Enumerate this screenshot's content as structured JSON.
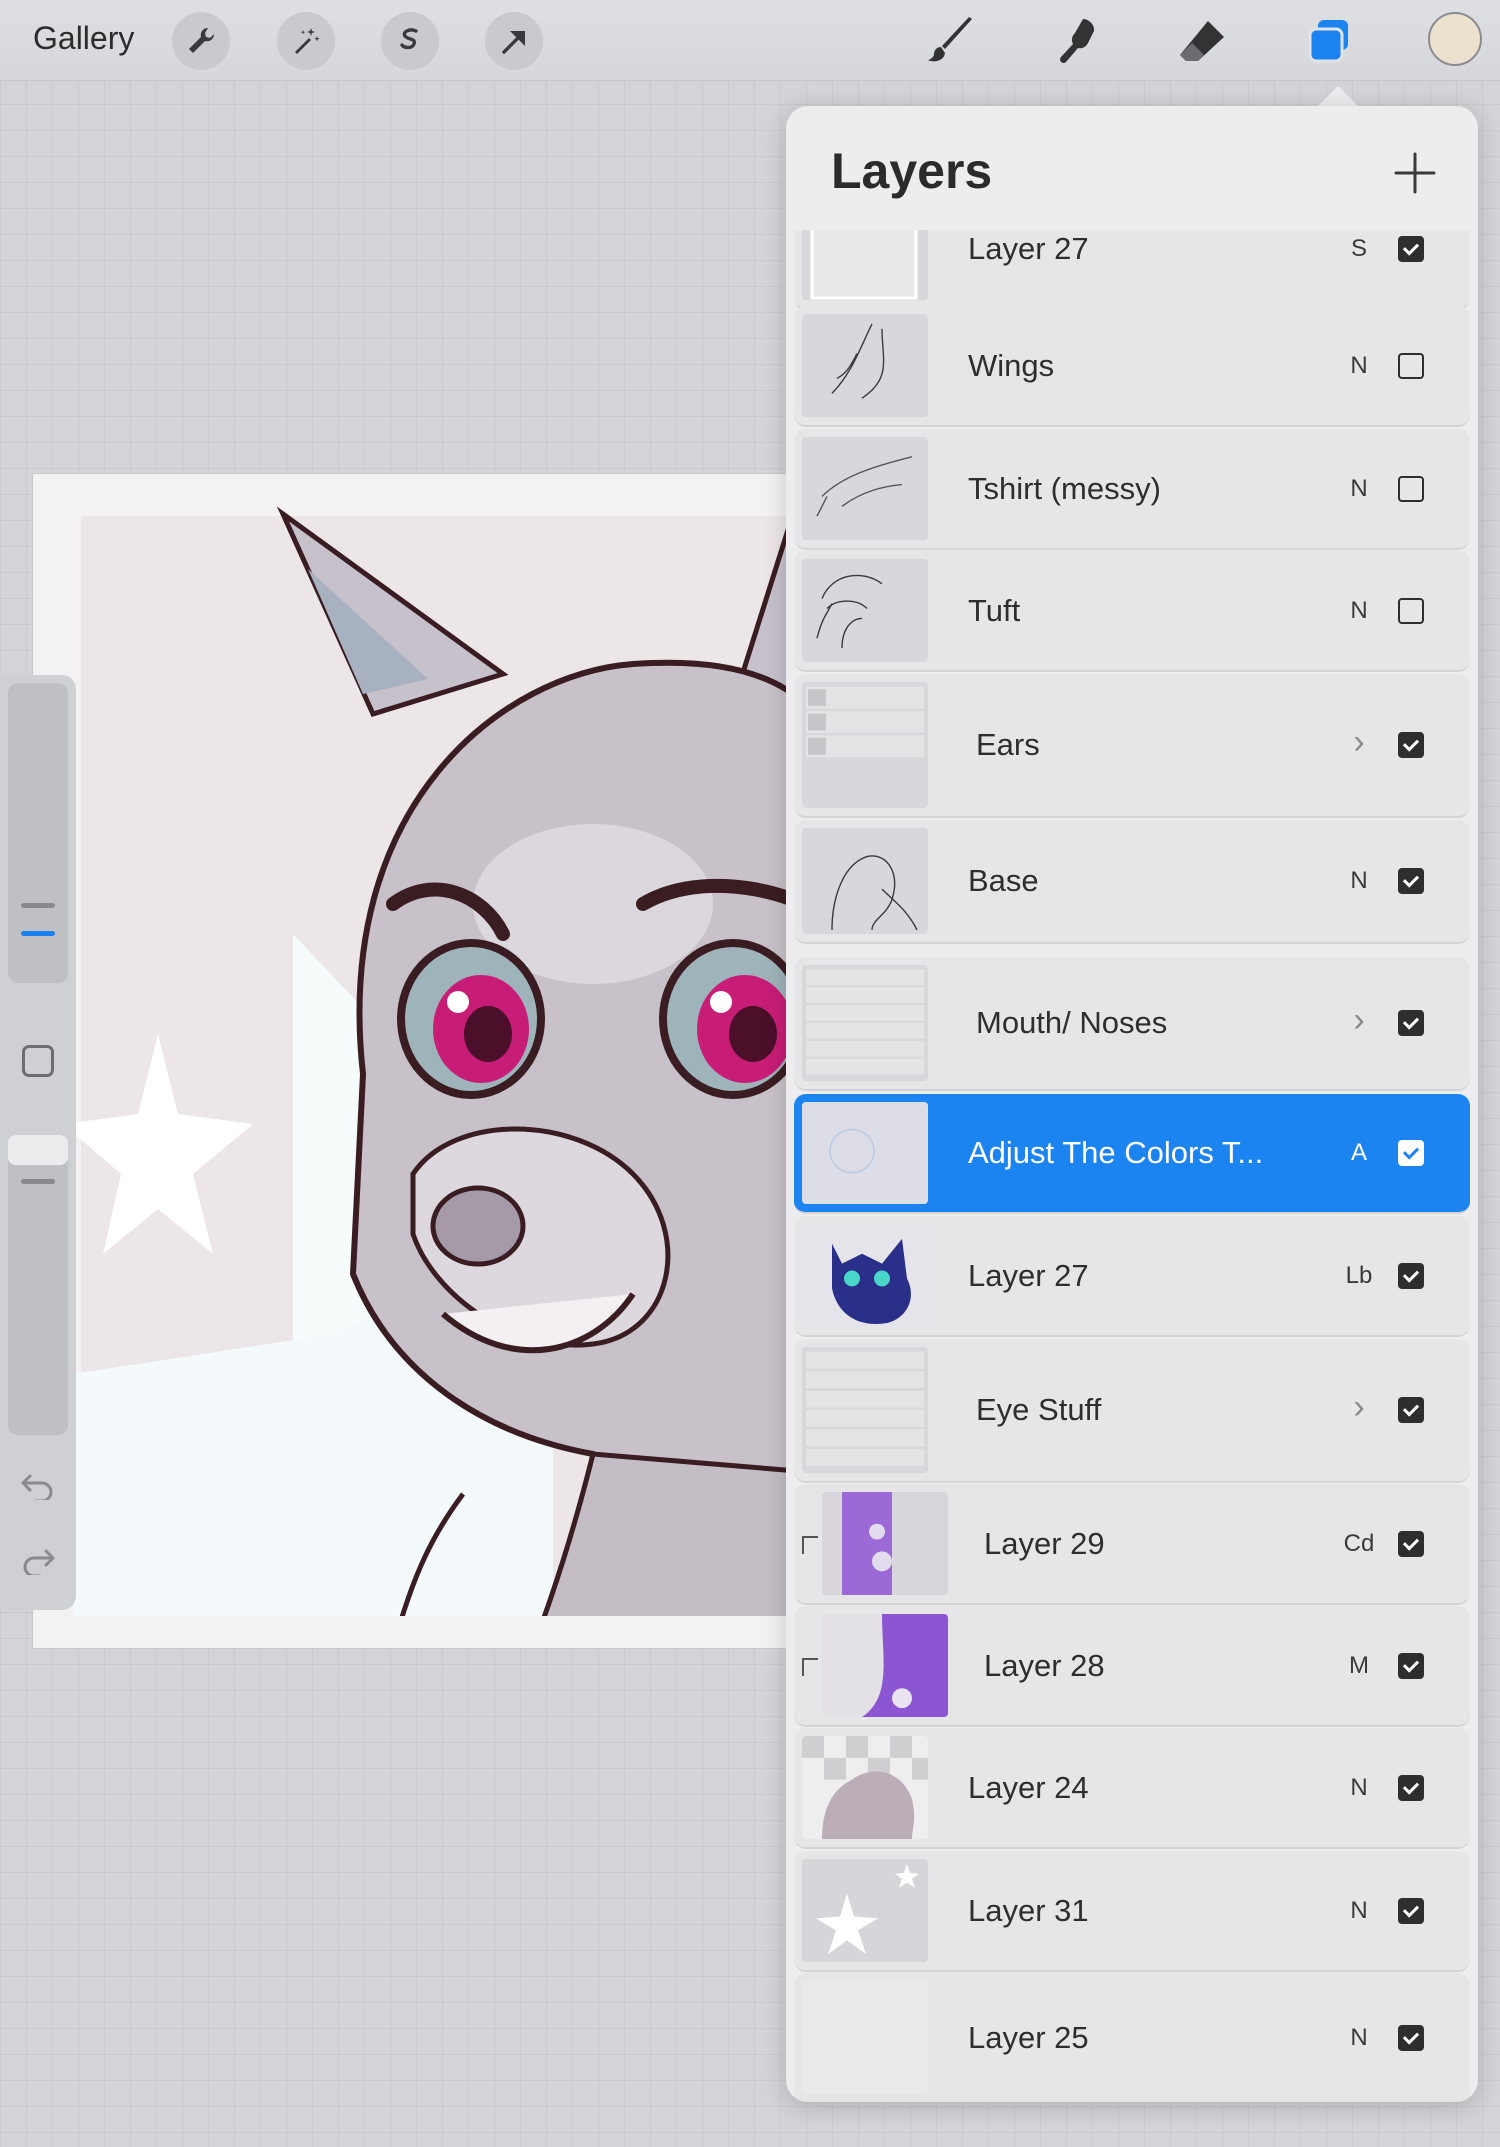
{
  "toolbar": {
    "gallery_label": "Gallery",
    "left_tools": [
      "wrench-icon",
      "magic-wand-icon",
      "selection-icon",
      "transform-arrow-icon"
    ],
    "right_tools": [
      "brush-icon",
      "smudge-icon",
      "eraser-icon",
      "layers-icon"
    ],
    "active_tool": "layers-icon",
    "current_color": "#ece0cf"
  },
  "panel": {
    "title": "Layers",
    "add_icon": "plus-icon",
    "layers": [
      {
        "name": "Layer 27",
        "blend": "S",
        "visible": true,
        "group": false,
        "clipped": false,
        "selected": false
      },
      {
        "name": "Wings",
        "blend": "N",
        "visible": false,
        "group": false,
        "clipped": false,
        "selected": false
      },
      {
        "name": "Tshirt (messy)",
        "blend": "N",
        "visible": false,
        "group": false,
        "clipped": false,
        "selected": false
      },
      {
        "name": "Tuft",
        "blend": "N",
        "visible": false,
        "group": false,
        "clipped": false,
        "selected": false
      },
      {
        "name": "Ears",
        "blend": "",
        "visible": true,
        "group": true,
        "clipped": false,
        "selected": false
      },
      {
        "name": "Base",
        "blend": "N",
        "visible": true,
        "group": false,
        "clipped": false,
        "selected": false
      },
      {
        "name": "Mouth/ Noses",
        "blend": "",
        "visible": true,
        "group": true,
        "clipped": false,
        "selected": false
      },
      {
        "name": "Adjust The Colors T...",
        "blend": "A",
        "visible": true,
        "group": false,
        "clipped": false,
        "selected": true
      },
      {
        "name": "Layer 27",
        "blend": "Lb",
        "visible": true,
        "group": false,
        "clipped": false,
        "selected": false
      },
      {
        "name": "Eye Stuff",
        "blend": "",
        "visible": true,
        "group": true,
        "clipped": false,
        "selected": false
      },
      {
        "name": "Layer 29",
        "blend": "Cd",
        "visible": true,
        "group": false,
        "clipped": true,
        "selected": false
      },
      {
        "name": "Layer 28",
        "blend": "M",
        "visible": true,
        "group": false,
        "clipped": true,
        "selected": false
      },
      {
        "name": "Layer 24",
        "blend": "N",
        "visible": true,
        "group": false,
        "clipped": false,
        "selected": false
      },
      {
        "name": "Layer 31",
        "blend": "N",
        "visible": true,
        "group": false,
        "clipped": false,
        "selected": false
      },
      {
        "name": "Layer 25",
        "blend": "N",
        "visible": true,
        "group": false,
        "clipped": false,
        "selected": false
      }
    ]
  },
  "sidebar": {
    "brush_size_icon": "brush-size-slider",
    "modify_icon": "modify-square-icon",
    "opacity_icon": "opacity-slider",
    "undo_icon": "undo-icon",
    "redo_icon": "redo-icon"
  },
  "colors": {
    "accent": "#1b84f0",
    "panel_bg": "#ededf0"
  }
}
